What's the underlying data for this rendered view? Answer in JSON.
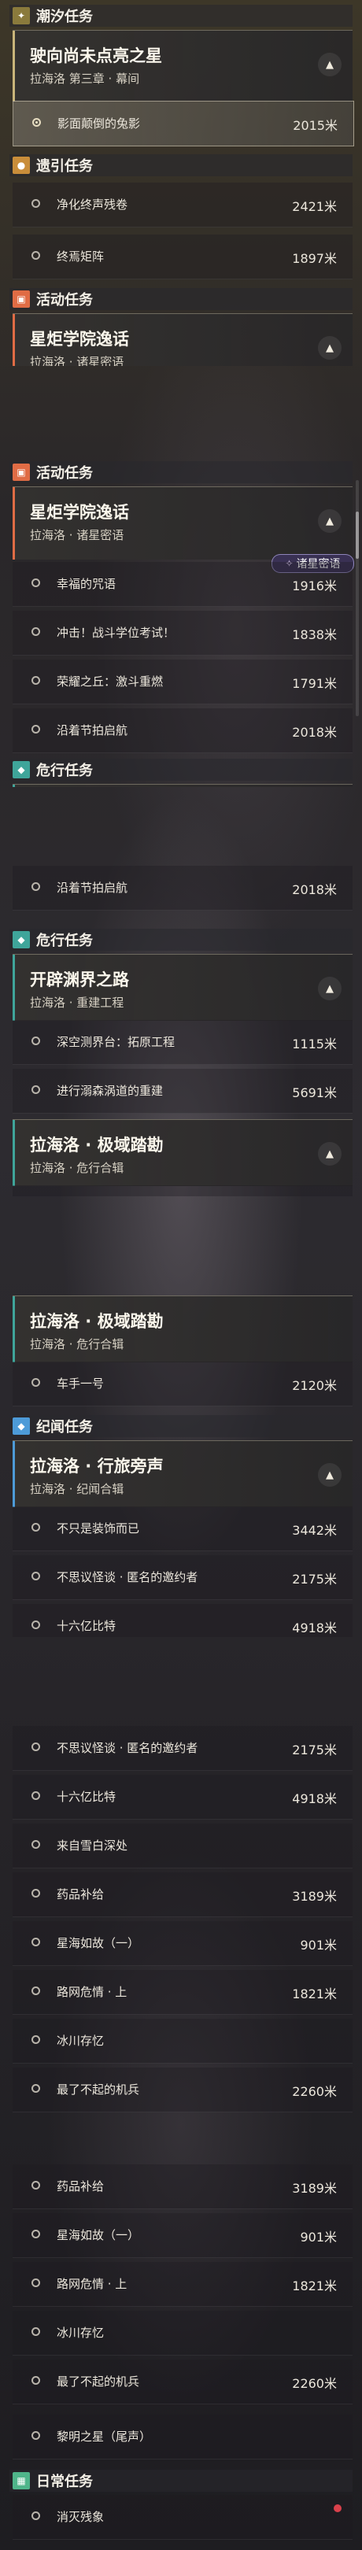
{
  "categories": {
    "tide": "潮汐任务",
    "companion": "遗引任务",
    "event": "活动任务",
    "crisis": "危行任务",
    "record": "纪闻任务",
    "daily": "日常任务"
  },
  "missions": {
    "star": {
      "title": "驶向尚未点亮之星",
      "sub": "拉海洛 第三章 · 幕间"
    },
    "academy": {
      "title": "星炬学院逸话",
      "sub": "拉海洛 · 诸星密语"
    },
    "path": {
      "title": "开辟渊界之路",
      "sub": "拉海洛 · 重建工程"
    },
    "explore": {
      "title": "拉海洛 · 极域踏勘",
      "sub": "拉海洛 · 危行合辑"
    },
    "travel": {
      "title": "拉海洛 · 行旅旁声",
      "sub": "拉海洛 · 纪闻合辑"
    }
  },
  "tasks": {
    "shadow": {
      "label": "影面颠倒的兔影",
      "dist": "2015米"
    },
    "purify": {
      "label": "净化终声残卷",
      "dist": "2421米"
    },
    "matrix": {
      "label": "终焉矩阵",
      "dist": "1897米"
    },
    "curse": {
      "label": "幸福的咒语",
      "dist": "1916米"
    },
    "exam": {
      "label": "冲击！战斗学位考试！",
      "dist": "1838米"
    },
    "hill": {
      "label": "荣耀之丘：激斗重燃",
      "dist": "1791米"
    },
    "festival": {
      "label": "沿着节拍启航",
      "dist": "2018米"
    },
    "platform": {
      "label": "深空测界台：拓原工程",
      "dist": "1115米"
    },
    "rebuild": {
      "label": "进行溺森涡道的重建",
      "dist": "5691米"
    },
    "driver": {
      "label": "车手一号",
      "dist": "2120米"
    },
    "notall": {
      "label": "不只是装饰而已",
      "dist": "3442米"
    },
    "strange": {
      "label": "不思议怪谈 · 匿名的邀约者",
      "dist": "2175米"
    },
    "billion": {
      "label": "十六亿比特",
      "dist": "4918米"
    },
    "snow": {
      "label": "来自雪白深处",
      "dist": ""
    },
    "supply": {
      "label": "药品补给",
      "dist": "3189米"
    },
    "seabreak1": {
      "label": "星海如故（一）",
      "dist": "901米"
    },
    "danger": {
      "label": "路网危情 · 上",
      "dist": "1821米"
    },
    "ice": {
      "label": "冰川存忆",
      "dist": ""
    },
    "mech": {
      "label": "最了不起的机兵",
      "dist": "2260米"
    },
    "dawn": {
      "label": "黎明之星（尾声）",
      "dist": ""
    },
    "vanish": {
      "label": "消灭残象",
      "dist": ""
    }
  },
  "tag": {
    "label": "诸星密语"
  },
  "icons": {
    "tide": "plus-icon",
    "companion": "location-pin-icon",
    "event": "ticket-icon",
    "crisis": "diamond-icon",
    "record": "diamond-icon",
    "daily": "calendar-icon",
    "collapse": "chevron-up-icon",
    "radio": "circle-icon"
  },
  "colors": {
    "tide": "#8a7a3c",
    "companion": "#c98d3a",
    "event": "#e06c45",
    "crisis": "#3fa59a",
    "record": "#4d9bd8",
    "daily": "#4fb58a",
    "notification": "#d9414b"
  }
}
